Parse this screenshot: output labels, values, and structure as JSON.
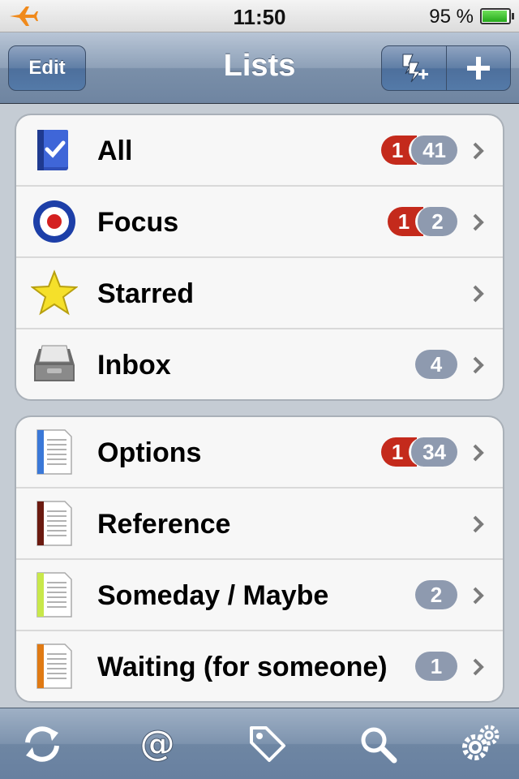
{
  "status": {
    "time": "11:50",
    "battery": "95 %"
  },
  "nav": {
    "title": "Lists",
    "edit_label": "Edit"
  },
  "groups": [
    {
      "rows": [
        {
          "label": "All",
          "red": "1",
          "gray": "41",
          "icon": "book-check-icon"
        },
        {
          "label": "Focus",
          "red": "1",
          "gray": "2",
          "icon": "target-icon"
        },
        {
          "label": "Starred",
          "icon": "star-icon"
        },
        {
          "label": "Inbox",
          "gray": "4",
          "icon": "inbox-tray-icon"
        }
      ]
    },
    {
      "rows": [
        {
          "label": "Options",
          "red": "1",
          "gray": "34",
          "icon": "document-icon",
          "color": "#3a78d8"
        },
        {
          "label": "Reference",
          "icon": "document-icon",
          "color": "#6b1a10"
        },
        {
          "label": "Someday / Maybe",
          "gray": "2",
          "icon": "document-icon",
          "color": "#c8e84a"
        },
        {
          "label": "Waiting (for someone)",
          "gray": "1",
          "icon": "document-icon",
          "color": "#e07a14"
        }
      ]
    }
  ],
  "toolbar": [
    "sync-icon",
    "at-sign-icon",
    "tag-icon",
    "search-icon",
    "settings-gears-icon"
  ],
  "colors": {
    "nav": "#7a8fa9",
    "badge_red": "#c42a1c",
    "badge_gray": "#8e9aaf"
  }
}
